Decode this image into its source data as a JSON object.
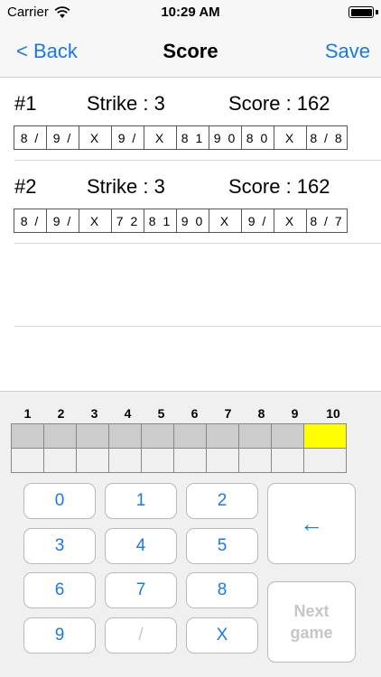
{
  "status_bar": {
    "carrier": "Carrier",
    "time": "10:29 AM"
  },
  "nav": {
    "back_label": "< Back",
    "title": "Score",
    "save_label": "Save"
  },
  "games": [
    {
      "number": "#1",
      "strike": "Strike : 3",
      "score": "Score : 162",
      "frames": [
        "8 /",
        "9 /",
        "X",
        "9 /",
        "X",
        "8 1",
        "9 0",
        "8 0",
        "X",
        "8 / 8"
      ]
    },
    {
      "number": "#2",
      "strike": "Strike : 3",
      "score": "Score : 162",
      "frames": [
        "8 /",
        "9 /",
        "X",
        "7 2",
        "8 1",
        "9 0",
        "X",
        "9 /",
        "X",
        "8 / 7"
      ]
    }
  ],
  "keypad": {
    "frame_numbers": [
      "1",
      "2",
      "3",
      "4",
      "5",
      "6",
      "7",
      "8",
      "9",
      "10"
    ],
    "current_frame": 10,
    "keys": [
      "0",
      "1",
      "2",
      "3",
      "4",
      "5",
      "6",
      "7",
      "8",
      "9",
      "/",
      "X"
    ],
    "backspace_label": "←",
    "next_label_line1": "Next",
    "next_label_line2": "game"
  },
  "colors": {
    "accent": "#1a7ae5",
    "current_frame": "#ffff00",
    "filled_cell": "#cccccc",
    "disabled": "#c6c6c6"
  },
  "icons": {
    "wifi": "wifi-icon",
    "battery": "battery-icon",
    "backspace": "backspace-icon"
  }
}
